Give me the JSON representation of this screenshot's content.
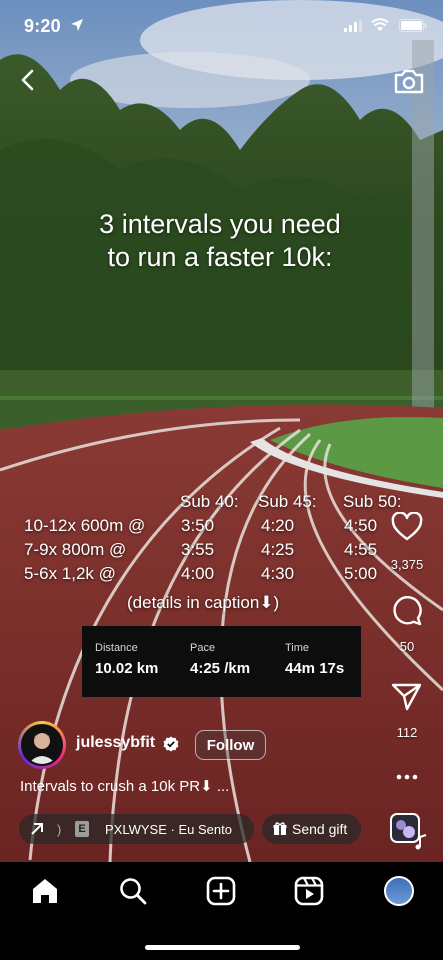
{
  "status_bar": {
    "time": "9:20"
  },
  "post": {
    "headline_line1": "3 intervals you need",
    "headline_line2": "to run a faster 10k:",
    "table": {
      "headers": [
        "Sub 40:",
        "Sub 45:",
        "Sub 50:"
      ],
      "rows": [
        {
          "label": "10-12x 600m @",
          "values": [
            "3:50",
            "4:20",
            "4:50"
          ]
        },
        {
          "label": "7-9x 800m @",
          "values": [
            "3:55",
            "4:25",
            "4:55"
          ]
        },
        {
          "label": "5-6x 1,2k @",
          "values": [
            "4:00",
            "4:30",
            "5:00"
          ]
        }
      ]
    },
    "details_note": "(details in caption⬇)",
    "stats": {
      "distance_label": "Distance",
      "distance_value": "10.02 km",
      "pace_label": "Pace",
      "pace_value": "4:25 /km",
      "time_label": "Time",
      "time_value": "44m 17s"
    }
  },
  "actions": {
    "likes": "3,375",
    "comments": "50",
    "shares": "112"
  },
  "author": {
    "username": "julessybfit",
    "follow_label": "Follow"
  },
  "caption": "Intervals to crush a 10k PR⬇ ...",
  "audio": {
    "text": "PXLWYSE · Eu Sento",
    "prefix": ")",
    "badge": "E"
  },
  "gift": {
    "label": "Send gift"
  },
  "colors": {
    "track": "#7a2d2a",
    "grass": "#4a8a3c",
    "sky": "#8aa7c9",
    "nav_bg": "#000000"
  }
}
